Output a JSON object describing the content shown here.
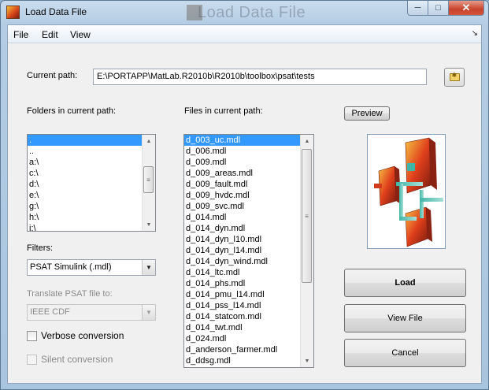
{
  "window": {
    "title": "Load Data File",
    "ghost_title": "Load Data File"
  },
  "menu": {
    "items": [
      "File",
      "Edit",
      "View"
    ],
    "dock_glyph": "↘"
  },
  "path": {
    "label": "Current path:",
    "value": "E:\\PORTAPP\\MatLab.R2010b\\R2010b\\toolbox\\psat\\tests"
  },
  "folders": {
    "label": "Folders in current path:",
    "items": [
      ".",
      "..",
      "a:\\",
      "c:\\",
      "d:\\",
      "e:\\",
      "g:\\",
      "h:\\",
      "i:\\"
    ],
    "selected_index": 0
  },
  "files": {
    "label": "Files in current path:",
    "items": [
      "d_003_uc.mdl",
      "d_006.mdl",
      "d_009.mdl",
      "d_009_areas.mdl",
      "d_009_fault.mdl",
      "d_009_hvdc.mdl",
      "d_009_svc.mdl",
      "d_014.mdl",
      "d_014_dyn.mdl",
      "d_014_dyn_l10.mdl",
      "d_014_dyn_l14.mdl",
      "d_014_dyn_wind.mdl",
      "d_014_ltc.mdl",
      "d_014_phs.mdl",
      "d_014_pmu_l14.mdl",
      "d_014_pss_l14.mdl",
      "d_014_statcom.mdl",
      "d_014_twt.mdl",
      "d_024.mdl",
      "d_anderson_farmer.mdl",
      "d_ddsg.mdl"
    ],
    "selected_index": 0
  },
  "filters": {
    "label": "Filters:",
    "value": "PSAT Simulink (.mdl)"
  },
  "translate": {
    "label": "Translate PSAT file to:",
    "value": "IEEE CDF"
  },
  "options": {
    "verbose": "Verbose conversion",
    "silent": "Silent conversion"
  },
  "buttons": {
    "preview": "Preview",
    "load": "Load",
    "view_file": "View File",
    "cancel": "Cancel"
  },
  "colors": {
    "selection": "#3399ff",
    "title_gradient_top": "#c9dced",
    "close_button": "#c8432c"
  }
}
